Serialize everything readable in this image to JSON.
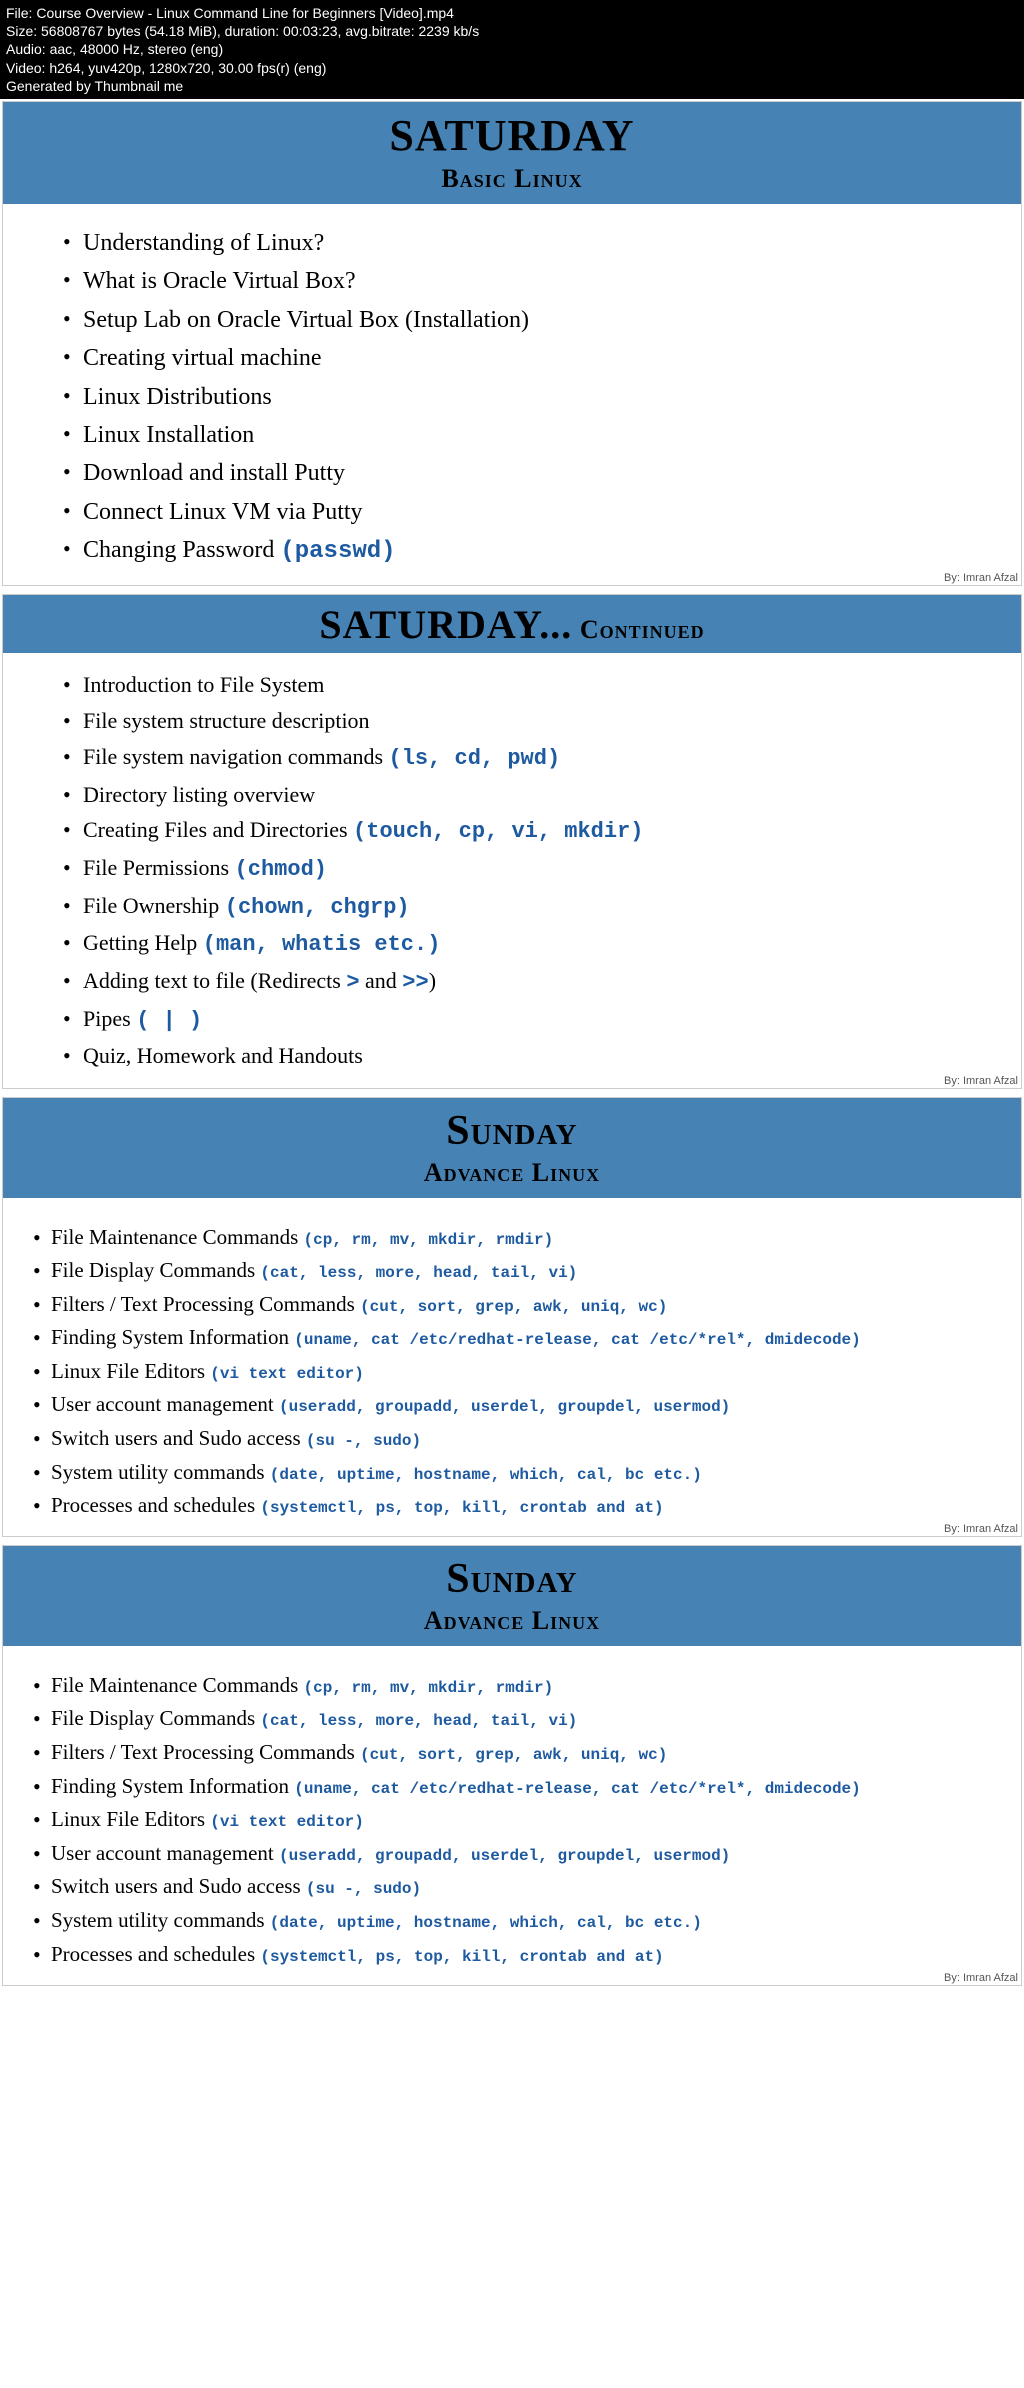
{
  "info": {
    "file": "File: Course Overview - Linux Command Line for Beginners [Video].mp4",
    "size": "Size: 56808767 bytes (54.18 MiB), duration: 00:03:23, avg.bitrate: 2239 kb/s",
    "audio": "Audio: aac, 48000 Hz, stereo (eng)",
    "video": "Video: h264, yuv420p, 1280x720, 30.00 fps(r) (eng)",
    "gen": "Generated by Thumbnail me"
  },
  "slide1": {
    "title": "SATURDAY",
    "subtitle": "Basic Linux",
    "items": {
      "0": "Understanding of Linux?",
      "1": "What is Oracle Virtual Box?",
      "2": "Setup Lab on Oracle Virtual Box (Installation)",
      "3": "Creating virtual machine",
      "4": "Linux Distributions",
      "5": "Linux Installation",
      "6": "Download and install Putty",
      "7": "Connect Linux VM via Putty",
      "8": "Changing Password ",
      "8m": "(passwd)"
    },
    "credit": "By: Imran Afzal"
  },
  "slide2": {
    "title": "SATURDAY...",
    "cont": " Continued",
    "items": {
      "0": "Introduction to File System",
      "1": "File system structure description",
      "2": "File system navigation commands ",
      "2m": "(ls, cd, pwd)",
      "3": "Directory listing overview",
      "4": "Creating Files and Directories ",
      "4m": "(touch, cp, vi, mkdir)",
      "5": "File Permissions ",
      "5m": "(chmod)",
      "6": "File Ownership ",
      "6m": "(chown, chgrp)",
      "7": "Getting Help ",
      "7m": "(man, whatis etc.)",
      "8a": "Adding text to file (Redirects ",
      "8m1": ">",
      "8b": " and ",
      "8m2": ">>",
      "8c": ")",
      "9": "Pipes ",
      "9m": "( | )",
      "10": "Quiz, Homework and Handouts"
    },
    "credit": "By: Imran Afzal"
  },
  "slide3": {
    "title": "Sunday",
    "subtitle": "Advance Linux",
    "items": {
      "0": "File Maintenance Commands ",
      "0m": "(cp, rm, mv, mkdir, rmdir)",
      "1": "File Display Commands ",
      "1m": "(cat, less, more, head, tail, vi)",
      "2": "Filters / Text Processing Commands ",
      "2m": "(cut, sort, grep, awk, uniq, wc)",
      "3": "Finding System Information ",
      "3m": "(uname, cat /etc/redhat-release, cat /etc/*rel*, dmidecode)",
      "4": "Linux File Editors ",
      "4m": "(vi text editor)",
      "5": "User account management ",
      "5m": "(useradd, groupadd, userdel, groupdel, usermod)",
      "6": "Switch users and Sudo access ",
      "6m": "(su -, sudo)",
      "7": "System utility commands ",
      "7m": "(date, uptime, hostname, which, cal, bc etc.)",
      "8": "Processes and schedules ",
      "8m": "(systemctl, ps, top, kill, crontab and at)"
    },
    "credit": "By: Imran Afzal"
  }
}
